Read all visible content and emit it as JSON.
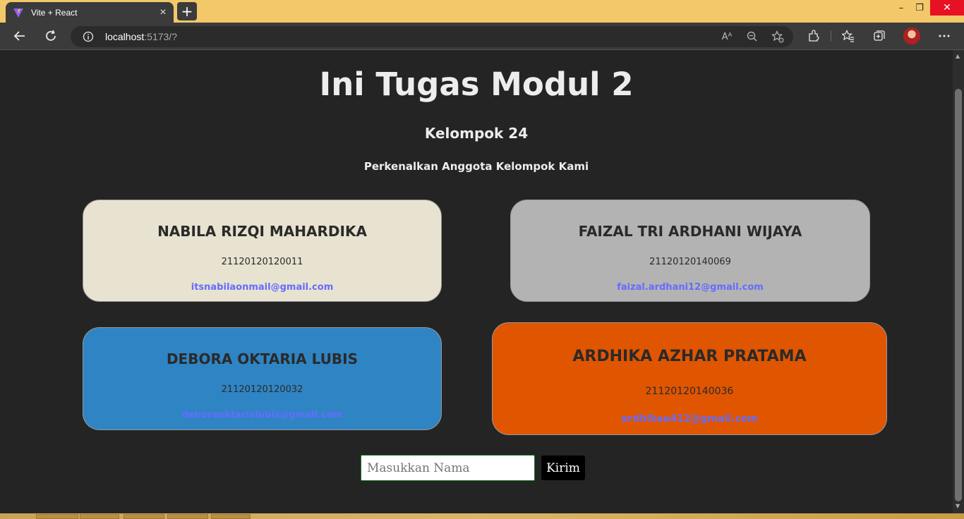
{
  "browser": {
    "tab_title": "Vite + React",
    "tab_close": "×",
    "new_tab": "+",
    "url_host": "localhost",
    "url_rest": ":5173/?",
    "window": {
      "minimize": "–",
      "maximize": "❐",
      "close": "✕"
    }
  },
  "page": {
    "title": "Ini Tugas Modul 2",
    "group": "Kelompok 24",
    "intro": "Perkenalkan Anggota Kelompok Kami",
    "members": [
      {
        "name": "NABILA RIZQI MAHARDIKA",
        "nim": "21120120120011",
        "email": "itsnabilaonmail@gmail.com",
        "color": "#e8e2d0"
      },
      {
        "name": "FAIZAL TRI ARDHANI WIJAYA",
        "nim": "21120120140069",
        "email": "faizal.ardhani12@gmail.com",
        "color": "#b3b3b3"
      },
      {
        "name": "DEBORA OKTARIA LUBIS",
        "nim": "21120120120032",
        "email": "deboraoktarialubis@gmail.com",
        "color": "#2f84c4"
      },
      {
        "name": "ARDHIKA AZHAR PRATAMA",
        "nim": "21120120140036",
        "email": "ardhikaa412@gmail.com",
        "color": "#e05500"
      }
    ],
    "form": {
      "placeholder": "Masukkan Nama",
      "value": "",
      "submit_label": "Kirim"
    }
  },
  "colors": {
    "page_bg": "#242424",
    "link": "#646cff",
    "titlebar": "#f2c86b"
  }
}
